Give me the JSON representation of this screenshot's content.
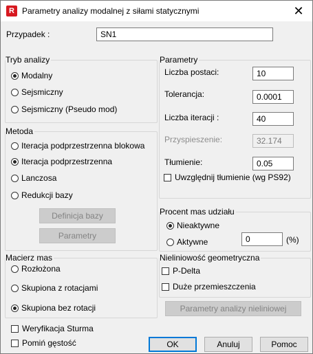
{
  "window": {
    "title": "Parametry analizy modalnej z siłami statycznymi",
    "app_icon_letter": "R",
    "close_glyph": "✕"
  },
  "case": {
    "label": "Przypadek :",
    "value": "SN1"
  },
  "analysis_mode": {
    "title": "Tryb analizy",
    "options": [
      {
        "label": "Modalny",
        "selected": true
      },
      {
        "label": "Sejsmiczny",
        "selected": false
      },
      {
        "label": "Sejsmiczny (Pseudo mod)",
        "selected": false
      }
    ]
  },
  "method": {
    "title": "Metoda",
    "options": [
      {
        "label": "Iteracja podprzestrzenna blokowa",
        "selected": false
      },
      {
        "label": "Iteracja podprzestrzenna",
        "selected": true
      },
      {
        "label": "Lanczosa",
        "selected": false
      },
      {
        "label": "Redukcji bazy",
        "selected": false
      }
    ],
    "base_def_button": "Definicja bazy",
    "params_button": "Parametry"
  },
  "mass_matrix": {
    "title": "Macierz mas",
    "options": [
      {
        "label": "Rozłożona",
        "selected": false
      },
      {
        "label": "Skupiona z rotacjami",
        "selected": false
      },
      {
        "label": "Skupiona bez rotacji",
        "selected": true
      }
    ]
  },
  "parameters": {
    "title": "Parametry",
    "mode_count": {
      "label": "Liczba postaci:",
      "value": "10"
    },
    "tolerance": {
      "label": "Tolerancja:",
      "value": "0.0001"
    },
    "iterations": {
      "label": "Liczba iteracji :",
      "value": "40"
    },
    "acceleration": {
      "label": "Przyspieszenie:",
      "value": "32.174"
    },
    "damping": {
      "label": "Tłumienie:",
      "value": "0.05"
    },
    "include_damping": {
      "label": "Uwzględnij tłumienie (wg PS92)",
      "checked": false
    }
  },
  "mass_participation": {
    "title": "Procent mas udziału",
    "inactive": {
      "label": "Nieaktywne",
      "selected": true
    },
    "active": {
      "label": "Aktywne",
      "selected": false
    },
    "value": "0",
    "unit": "(%)"
  },
  "geometric_nonlinearity": {
    "title": "Nieliniowość geometryczna",
    "p_delta": {
      "label": "P-Delta",
      "checked": false
    },
    "large_displacements": {
      "label": "Duże przemieszczenia",
      "checked": false
    },
    "nonlinear_params_button": "Parametry analizy nieliniowej"
  },
  "sturm_check": {
    "label": "Weryfikacja Sturma",
    "checked": false
  },
  "skip_density": {
    "label": "Pomiń gęstość",
    "checked": false
  },
  "buttons": {
    "ok": "OK",
    "cancel": "Anuluj",
    "help": "Pomoc"
  }
}
